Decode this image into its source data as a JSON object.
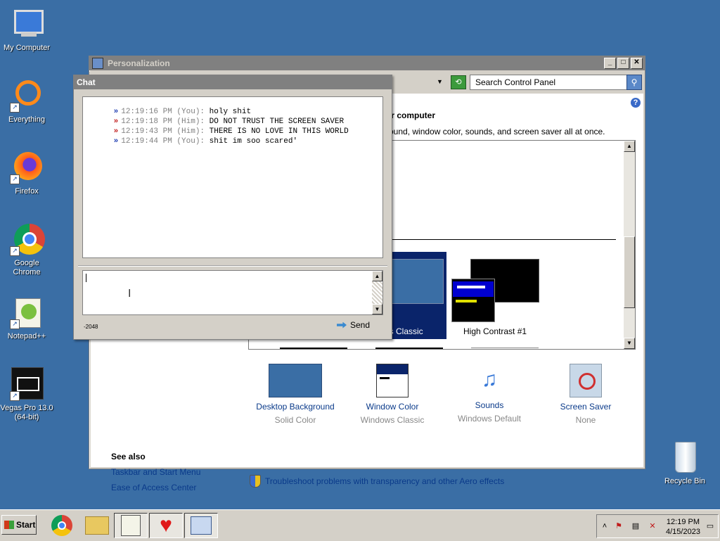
{
  "desktop": {
    "icons": [
      {
        "label": "My Computer"
      },
      {
        "label": "Everything"
      },
      {
        "label": "Firefox"
      },
      {
        "label": "Google Chrome"
      },
      {
        "label": "Notepad++"
      },
      {
        "label": "Vegas Pro 13.0\n(64-bit)"
      },
      {
        "label": "Recycle Bin"
      }
    ]
  },
  "personalization": {
    "title": "Personalization",
    "search_placeholder": "Search Control Panel",
    "heading": "ur computer",
    "subheading": "round, window color, sounds, and screen saver all at once.",
    "themes": [
      {
        "label": "ws Classic"
      },
      {
        "label": "High Contrast #1"
      }
    ],
    "shortcuts": [
      {
        "title": "Desktop Background",
        "sub": "Solid Color"
      },
      {
        "title": "Window Color",
        "sub": "Windows Classic"
      },
      {
        "title": "Sounds",
        "sub": "Windows Default"
      },
      {
        "title": "Screen Saver",
        "sub": "None"
      }
    ],
    "see_also": {
      "title": "See also",
      "links": [
        "Taskbar and Start Menu",
        "Ease of Access Center"
      ]
    },
    "troubleshoot": "Troubleshoot problems with transparency and other Aero effects"
  },
  "chat": {
    "title": "Chat",
    "messages": [
      {
        "time": "12:19:16 PM (You):",
        "text": "holy shit",
        "color": "#1a3ab0"
      },
      {
        "time": "12:19:18 PM (Him):",
        "text": "DO NOT TRUST THE SCREEN SAVER",
        "color": "#c01a1a"
      },
      {
        "time": "12:19:43 PM (Him):",
        "text": "THERE IS NO LOVE IN THIS WORLD",
        "color": "#c01a1a"
      },
      {
        "time": "12:19:44 PM (You):",
        "text": "shit im soo scared'",
        "color": "#1a3ab0"
      }
    ],
    "arrow_glyph": "»",
    "char_count": "-2048",
    "send_label": "Send",
    "input_value": ""
  },
  "taskbar": {
    "start_label": "Start",
    "clock_time": "12:19 PM",
    "clock_date": "4/15/2023"
  }
}
